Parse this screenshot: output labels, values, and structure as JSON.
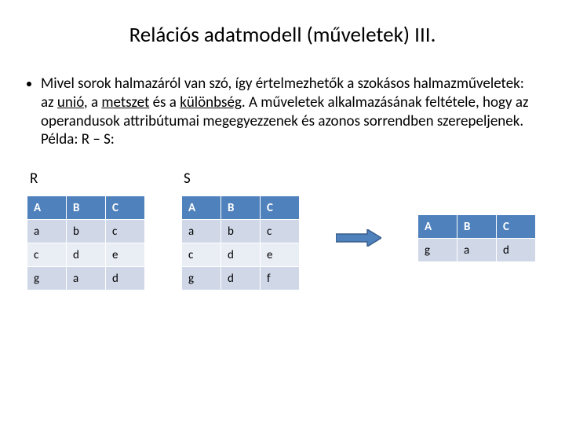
{
  "title": "Relációs adatmodell (műveletek) III.",
  "paragraph": {
    "pre": "Mivel sorok halmazáról van szó, így értelmezhetők a szokásos halmazműveletek: az ",
    "u1": "unió",
    "mid1": ", a ",
    "u2": "metszet",
    "mid2": " és a ",
    "u3": "különbség",
    "post": ". A műveletek alkalmazásának feltétele, hogy az operandusok attribútumai megegyezzenek és azonos sorrendben szerepeljenek. Példa: R – S:"
  },
  "labels": {
    "R": "R",
    "S": "S"
  },
  "tables": {
    "R": {
      "headers": [
        "A",
        "B",
        "C"
      ],
      "rows": [
        [
          "a",
          "b",
          "c"
        ],
        [
          "c",
          "d",
          "e"
        ],
        [
          "g",
          "a",
          "d"
        ]
      ]
    },
    "S": {
      "headers": [
        "A",
        "B",
        "C"
      ],
      "rows": [
        [
          "a",
          "b",
          "c"
        ],
        [
          "c",
          "d",
          "e"
        ],
        [
          "g",
          "d",
          "f"
        ]
      ]
    },
    "Result": {
      "headers": [
        "A",
        "B",
        "C"
      ],
      "rows": [
        [
          "g",
          "a",
          "d"
        ]
      ]
    }
  },
  "colors": {
    "header_bg": "#4f81bd",
    "band_a": "#d0d8e8",
    "band_b": "#e9edf4",
    "arrow_fill": "#4f81bd",
    "arrow_stroke": "#385d8a"
  }
}
